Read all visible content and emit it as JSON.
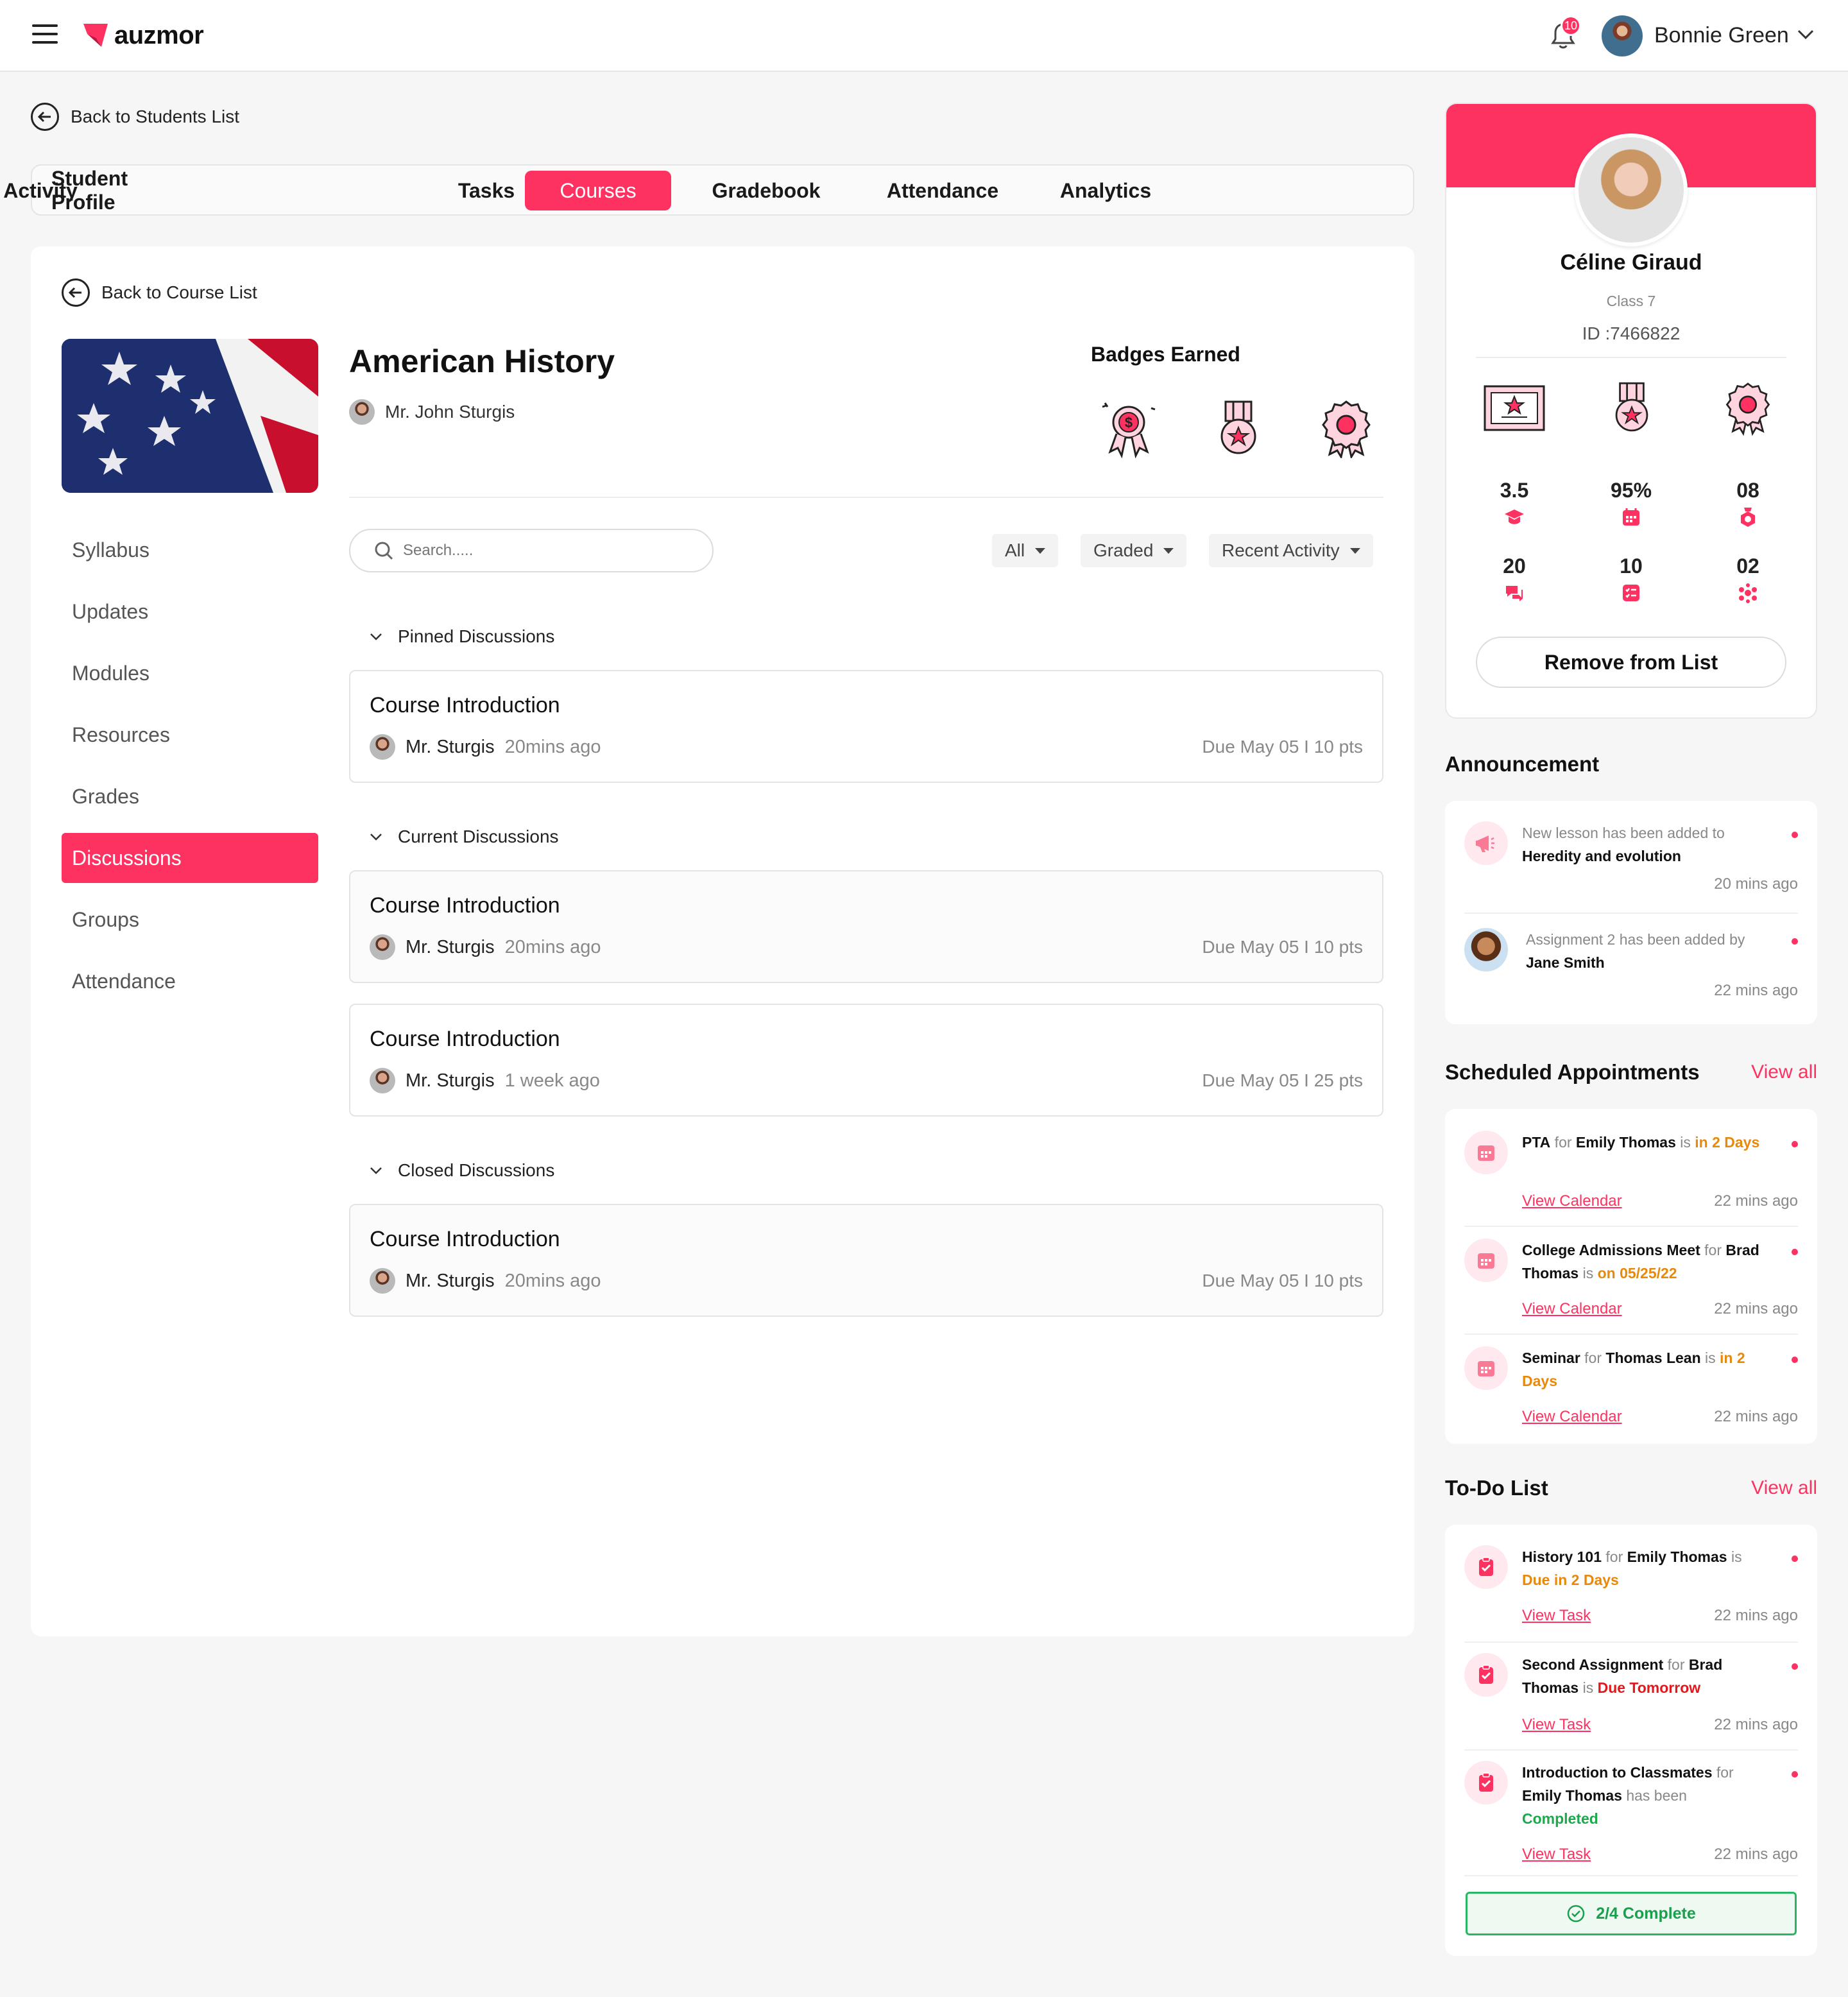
{
  "header": {
    "brand": "auzmor",
    "notification_count": "10",
    "user_name": "Bonnie Green"
  },
  "nav": {
    "back_students": "Back to Students List",
    "back_course": "Back to Course List"
  },
  "tabs": [
    {
      "label": "Student Profile"
    },
    {
      "label": "Activity"
    },
    {
      "label": "Tasks"
    },
    {
      "label": "Courses"
    },
    {
      "label": "Gradebook"
    },
    {
      "label": "Attendance"
    },
    {
      "label": "Analytics"
    }
  ],
  "active_tab": "Courses",
  "course": {
    "title": "American History",
    "teacher": "Mr. John Sturgis",
    "badges_title": "Badges Earned"
  },
  "sidebar": [
    {
      "label": "Syllabus"
    },
    {
      "label": "Updates"
    },
    {
      "label": "Modules"
    },
    {
      "label": "Resources"
    },
    {
      "label": "Grades"
    },
    {
      "label": "Discussions"
    },
    {
      "label": "Groups"
    },
    {
      "label": "Attendance"
    }
  ],
  "active_sidebar": "Discussions",
  "search": {
    "placeholder": "Search....."
  },
  "filters": {
    "all": "All",
    "graded": "Graded",
    "recent": "Recent Activity"
  },
  "sections": {
    "pinned": "Pinned Discussions",
    "current": "Current  Discussions",
    "closed": "Closed  Discussions"
  },
  "discussions": [
    {
      "title": "Course Introduction",
      "author": "Mr. Sturgis",
      "ago": "20mins ago",
      "due": "Due May 05 I 10 pts"
    },
    {
      "title": "Course Introduction",
      "author": "Mr. Sturgis",
      "ago": "20mins ago",
      "due": "Due May 05 I 10 pts"
    },
    {
      "title": "Course Introduction",
      "author": "Mr. Sturgis",
      "ago": "1 week ago",
      "due": "Due May 05 I 25 pts"
    },
    {
      "title": "Course Introduction",
      "author": "Mr. Sturgis",
      "ago": "20mins ago",
      "due": "Due May 05 I 10 pts"
    }
  ],
  "profile": {
    "name": "Céline Giraud",
    "class": "Class 7",
    "id": "ID :7466822",
    "stats": [
      {
        "value": "3.5",
        "icon": "graduation-cap-icon"
      },
      {
        "value": "95%",
        "icon": "calendar-icon"
      },
      {
        "value": "08",
        "icon": "badge-icon"
      },
      {
        "value": "20",
        "icon": "chat-icon"
      },
      {
        "value": "10",
        "icon": "checklist-icon"
      },
      {
        "value": "02",
        "icon": "group-icon"
      }
    ],
    "remove_label": "Remove from List"
  },
  "announcement": {
    "title": "Announcement",
    "items": [
      {
        "pre": "New lesson has been added to ",
        "bold": "Heredity and evolution",
        "time": "20 mins ago"
      },
      {
        "pre": "Assignment 2 has been added by ",
        "bold": "Jane Smith",
        "time": "22 mins ago"
      }
    ]
  },
  "appointments": {
    "title": "Scheduled Appointments",
    "view_all": "View all",
    "link": "View Calendar",
    "items": [
      {
        "event": "PTA",
        "for": " for ",
        "person": "Emily Thomas",
        "is": " is ",
        "when": "in 2 Days",
        "time": "22 mins ago"
      },
      {
        "event": "College Admissions Meet",
        "for": " for ",
        "person": "Brad Thomas",
        "is": " is ",
        "when": "on 05/25/22",
        "time": "22 mins ago"
      },
      {
        "event": "Seminar",
        "for": " for ",
        "person": "Thomas Lean",
        "is": " is ",
        "when": "in 2 Days",
        "time": "22 mins ago"
      }
    ]
  },
  "todo": {
    "title": "To-Do List",
    "view_all": "View all",
    "link": "View Task",
    "items": [
      {
        "task": "History 101",
        "for": " for ",
        "person": "Emily Thomas",
        "is": " is ",
        "status": "Due in 2 Days",
        "time": "22 mins ago"
      },
      {
        "task": "Second Assignment",
        "for": " for ",
        "person": "Brad Thomas",
        "is": " is ",
        "status": "Due Tomorrow",
        "time": "22 mins ago"
      },
      {
        "task": "Introduction to Classmates",
        "for": " for ",
        "person": "Emily Thomas",
        "is": " has been ",
        "status": "Completed",
        "time": "22 mins ago"
      }
    ],
    "complete_label": "2/4 Complete"
  },
  "colors": {
    "accent": "#fd3261",
    "orange": "#e8890c",
    "red": "#e0191f",
    "green": "#1ba94c"
  }
}
